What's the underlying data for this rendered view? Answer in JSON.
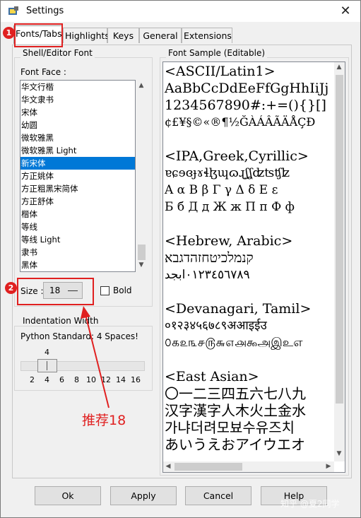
{
  "window": {
    "title": "Settings",
    "close_glyph": "✕"
  },
  "tabs": [
    "Fonts/Tabs",
    "Highlights",
    "Keys",
    "General",
    "Extensions"
  ],
  "shell_group": {
    "label": "Shell/Editor Font",
    "font_face_label": "Font Face :",
    "fonts": [
      "华文行楷",
      "华文隶书",
      "宋体",
      "幼圆",
      "微软雅黑",
      "微软雅黑 Light",
      "新宋体",
      "方正姚体",
      "方正粗黑宋简体",
      "方正舒体",
      "楷体",
      "等线",
      "等线 Light",
      "隶书",
      "黑体"
    ],
    "selected_font": "新宋体",
    "size_label": "Size :",
    "size_value": "18",
    "bold_label": "Bold"
  },
  "indent_group": {
    "label": "Indentation Width",
    "note": "Python Standard: 4 Spaces!",
    "value": "4",
    "ticks": [
      "2",
      "4",
      "6",
      "8",
      "10",
      "12",
      "14",
      "16"
    ]
  },
  "sample_group": {
    "label": "Font Sample (Editable)",
    "lines": [
      "<ASCII/Latin1>",
      "AaBbCcDdEeFfGgHhIiJj",
      "1234567890#:+=(){}[]",
      "¢£¥§©«®¶½ĞÀÁÂÃÄÅÇÐ",
      "",
      "<IPA,Greek,Cyrillic>",
      "ɐɕɘɞɟɤɬɮɰɷɻʃʆʣʦʧʫ",
      "A α B β Γ γ Δ δ Ε ε",
      "Б б Д д Ж ж П п Ф ф",
      "",
      "<Hebrew, Arabic>",
      "קנמלכיטחזהדגבא",
      "٠١٢٣٤٥٦٧٨٩ابجد",
      "",
      "<Devanagari, Tamil>",
      "०१२३४५६७८९अआइईउ",
      "௦௧௨௩௪௫௬௭௮௯அஇஉஎ",
      "",
      "<East Asian>",
      "〇一二三四五六七八九",
      "汉字漢字人木火土金水",
      "가냐더려모뵤수유즈치",
      "あいうえおアイウエオ"
    ]
  },
  "buttons": {
    "ok": "Ok",
    "apply": "Apply",
    "cancel": "Cancel",
    "help": "Help"
  },
  "annotations": {
    "badge1": "1",
    "badge2": "2",
    "recommend": "推荐18",
    "accent_color": "#e02020"
  },
  "watermark": "知乎 @夏2同学"
}
